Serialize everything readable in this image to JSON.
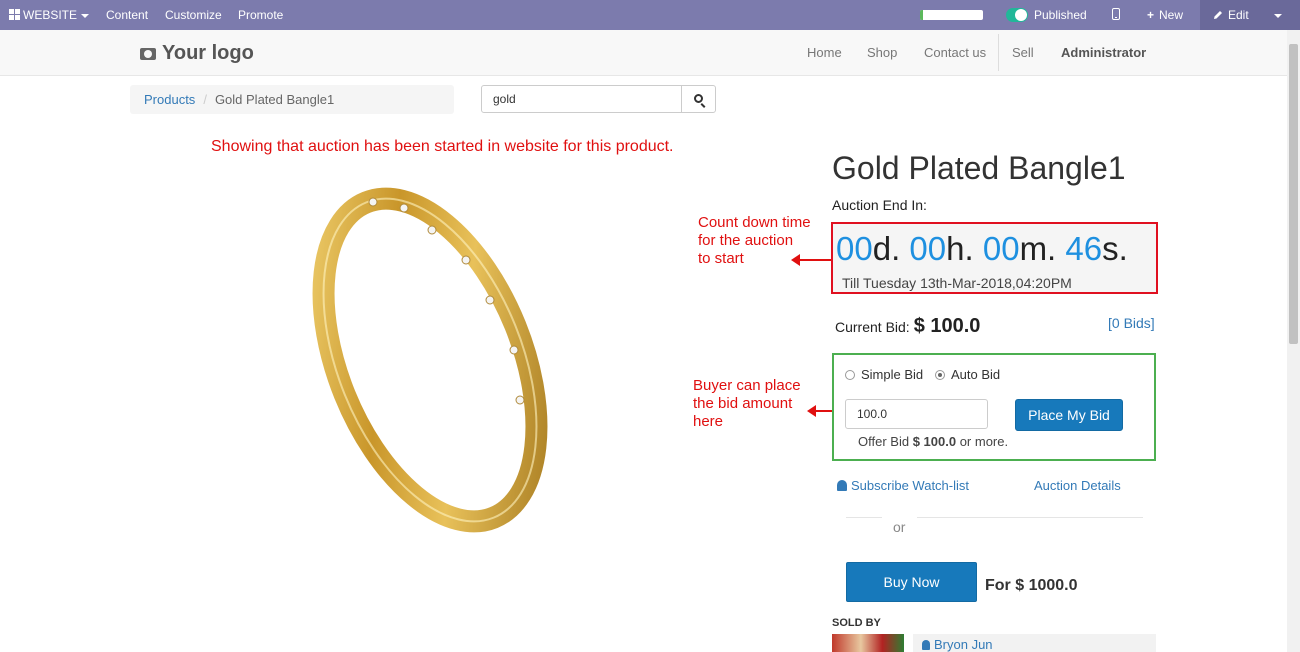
{
  "adminbar": {
    "website": "WEBSITE",
    "content": "Content",
    "customize": "Customize",
    "promote": "Promote",
    "published": "Published",
    "new": "New",
    "edit": "Edit",
    "progress": 0.05
  },
  "navbar": {
    "logo": "Your logo",
    "home": "Home",
    "shop": "Shop",
    "contact": "Contact us",
    "sell": "Sell",
    "user": "Administrator"
  },
  "breadcrumb": {
    "parent": "Products",
    "current": "Gold Plated Bangle1"
  },
  "search": {
    "value": "gold"
  },
  "annotations": {
    "top": "Showing that auction has been started in website for this product.",
    "countdown_1": "Count down time",
    "countdown_2": "for the auction",
    "countdown_3": "to start",
    "bid_1": "Buyer can place",
    "bid_2": "the bid amount",
    "bid_3": "here"
  },
  "product": {
    "title": "Gold Plated Bangle1",
    "auction_label": "Auction End In:",
    "countdown": {
      "days": "00",
      "hours": "00",
      "minutes": "00",
      "seconds": "46"
    },
    "till": "Till Tuesday 13th-Mar-2018,04:20PM",
    "current_bid_label": "Current Bid:",
    "current_bid": "$ 100.0",
    "bids_link": "[0 Bids]",
    "simple_bid": "Simple Bid",
    "auto_bid": "Auto Bid",
    "bid_value": "100.0",
    "place_bid": "Place My Bid",
    "offer_prefix": "Offer Bid",
    "offer_amount": "$ 100.0",
    "offer_suffix": "or more.",
    "watchlist": "Subscribe Watch-list",
    "auction_details": "Auction Details",
    "or": "or",
    "buy_now": "Buy Now",
    "buy_price": "For $ 1000.0",
    "sold_by": "SOLD BY",
    "seller": "Bryon Jun"
  }
}
